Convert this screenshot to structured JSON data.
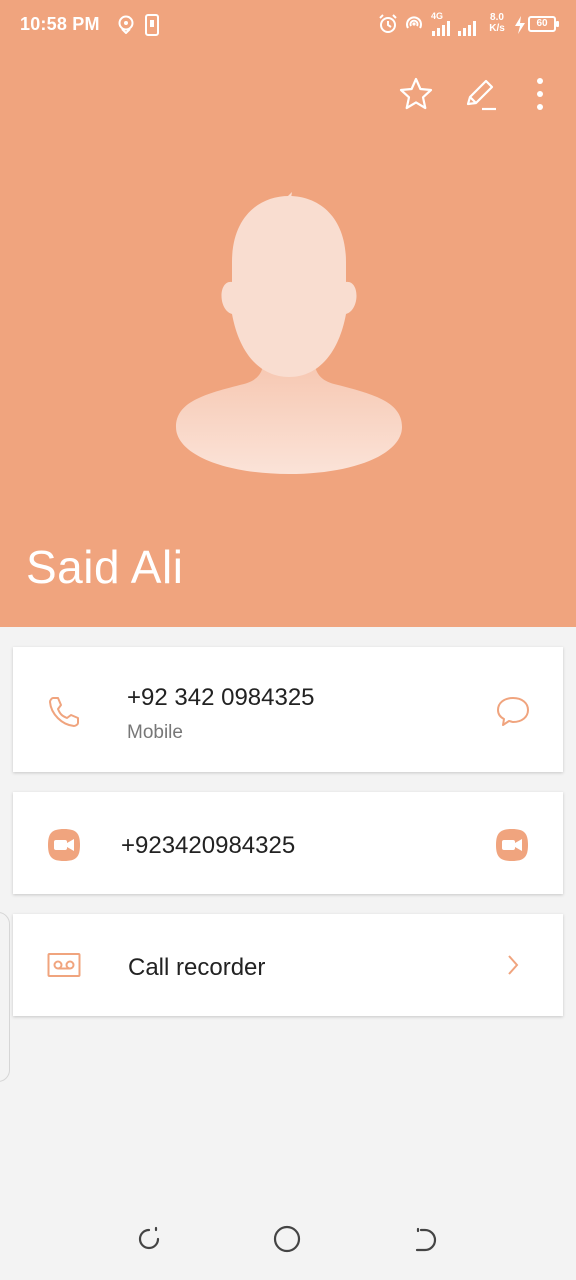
{
  "status_bar": {
    "time": "10:58 PM",
    "network_speed_value": "8.0",
    "network_speed_unit": "K/s",
    "network_type": "4G",
    "battery_level": "60",
    "icons": [
      "location-icon",
      "sim-icon",
      "alarm-icon",
      "hotspot-icon",
      "signal-icon",
      "signal-icon",
      "charging-icon",
      "battery-icon"
    ]
  },
  "toolbar": {
    "favorite_icon": "star-icon",
    "edit_icon": "edit-icon",
    "more_icon": "more-vert-icon"
  },
  "contact": {
    "name": "Said Ali"
  },
  "phone_entry": {
    "number": "+92 342 0984325",
    "type": "Mobile",
    "call_icon": "phone-icon",
    "message_icon": "message-icon"
  },
  "video_entry": {
    "number": "+923420984325",
    "icon": "video-call-icon"
  },
  "recorder_entry": {
    "label": "Call recorder",
    "icon": "voicemail-icon",
    "arrow_icon": "chevron-right-icon"
  },
  "nav_bar": {
    "icons": [
      "recents-icon",
      "home-icon",
      "back-icon"
    ]
  },
  "colors": {
    "accent": "#f0a47e",
    "background": "#f3f3f3",
    "card": "#ffffff"
  }
}
